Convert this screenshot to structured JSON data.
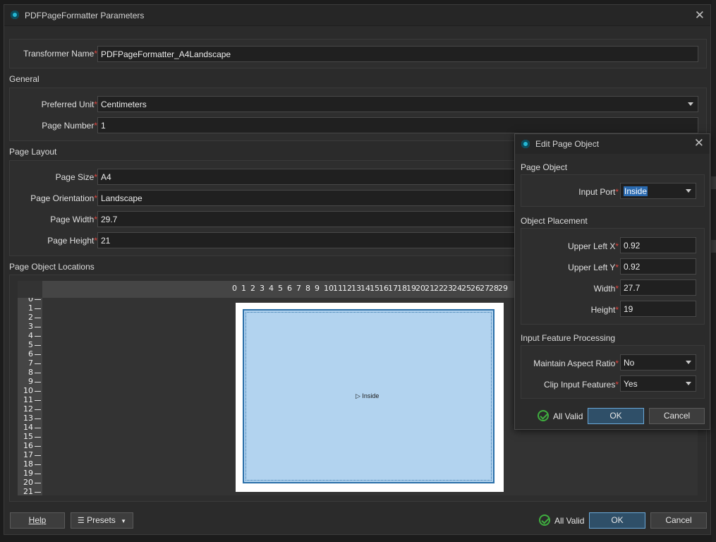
{
  "window": {
    "title": "PDFPageFormatter Parameters",
    "close_symbol": "✕"
  },
  "transformer_name": {
    "label": "Transformer Name",
    "value": "PDFPageFormatter_A4Landscape"
  },
  "general": {
    "title": "General",
    "preferred_unit": {
      "label": "Preferred Unit",
      "value": "Centimeters"
    },
    "page_number": {
      "label": "Page Number",
      "value": "1"
    }
  },
  "page_layout": {
    "title": "Page Layout",
    "page_size": {
      "label": "Page Size",
      "value": "A4"
    },
    "page_orientation": {
      "label": "Page Orientation",
      "value": "Landscape"
    },
    "page_width": {
      "label": "Page Width",
      "value": "29.7"
    },
    "page_height": {
      "label": "Page Height",
      "value": "21"
    }
  },
  "page_object_locations": {
    "title": "Page Object Locations",
    "ruler_x": [
      "0",
      "1",
      "2",
      "3",
      "4",
      "5",
      "6",
      "7",
      "8",
      "9",
      "10",
      "11",
      "12",
      "13",
      "14",
      "15",
      "16",
      "17",
      "18",
      "19",
      "20",
      "21",
      "22",
      "23",
      "24",
      "25",
      "26",
      "27",
      "28",
      "29"
    ],
    "ruler_y": [
      "0",
      "1",
      "2",
      "3",
      "4",
      "5",
      "6",
      "7",
      "8",
      "9",
      "10",
      "11",
      "12",
      "13",
      "14",
      "15",
      "16",
      "17",
      "18",
      "19",
      "20",
      "21"
    ],
    "object_label": "Inside"
  },
  "footer": {
    "help": "Help",
    "presets": "Presets",
    "status": "All Valid",
    "ok": "OK",
    "cancel": "Cancel"
  },
  "edit_dialog": {
    "title": "Edit Page Object",
    "page_object": {
      "title": "Page Object",
      "input_port": {
        "label": "Input Port",
        "value": "Inside"
      }
    },
    "object_placement": {
      "title": "Object Placement",
      "upper_left_x": {
        "label": "Upper Left X",
        "value": "0.92"
      },
      "upper_left_y": {
        "label": "Upper Left Y",
        "value": "0.92"
      },
      "width": {
        "label": "Width",
        "value": "27.7"
      },
      "height": {
        "label": "Height",
        "value": "19"
      }
    },
    "input_feature_processing": {
      "title": "Input Feature Processing",
      "maintain_aspect_ratio": {
        "label": "Maintain Aspect Ratio",
        "value": "No"
      },
      "clip_input_features": {
        "label": "Clip Input Features",
        "value": "Yes"
      }
    },
    "status": "All Valid",
    "ok": "OK",
    "cancel": "Cancel"
  }
}
